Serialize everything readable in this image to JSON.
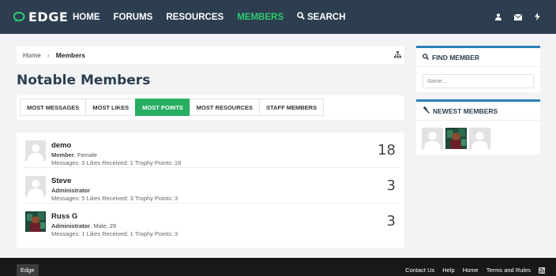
{
  "colors": {
    "header_bg": "#2c3e50",
    "accent": "#27ae60",
    "active_nav": "#2ecc71",
    "sidebar_border": "#2980b9",
    "footer_bg": "#161819"
  },
  "brand": {
    "name": "EDGE",
    "icon": "speech-bubble-logo-icon"
  },
  "nav": {
    "items": [
      {
        "label": "HOME"
      },
      {
        "label": "FORUMS"
      },
      {
        "label": "RESOURCES"
      },
      {
        "label": "MEMBERS",
        "active": true
      },
      {
        "label": "SEARCH",
        "icon": "search-icon"
      }
    ],
    "right_icons": [
      "user-icon",
      "envelope-icon",
      "bolt-icon"
    ]
  },
  "breadcrumb": {
    "home": "Home",
    "separator": "›",
    "current": "Members",
    "icon": "sitemap-icon"
  },
  "page_title": "Notable Members",
  "tabs": [
    {
      "label": "MOST MESSAGES"
    },
    {
      "label": "MOST LIKES"
    },
    {
      "label": "MOST POINTS",
      "active": true
    },
    {
      "label": "MOST RESOURCES"
    },
    {
      "label": "STAFF MEMBERS"
    }
  ],
  "members": [
    {
      "name": "demo",
      "role": "Member",
      "extra": ", Female",
      "stats": "Messages: 0 Likes Received: 1 Trophy Points: 18",
      "points": "18",
      "avatar": "default-avatar"
    },
    {
      "name": "Steve",
      "role": "Administrator",
      "extra": "",
      "stats": "Messages: 5 Likes Received: 3 Trophy Points: 3",
      "points": "3",
      "avatar": "default-avatar"
    },
    {
      "name": "Russ G",
      "role": "Administrator",
      "extra": ", Male, 29",
      "stats": "Messages: 1 Likes Received: 1 Trophy Points: 3",
      "points": "3",
      "avatar": "photo-avatar"
    }
  ],
  "sidebar": {
    "find": {
      "title": "FIND MEMBER",
      "icon": "search-icon",
      "placeholder": "Name..."
    },
    "newest": {
      "title": "NEWEST MEMBERS",
      "icon": "gavel-icon",
      "avatars": [
        "default-avatar",
        "photo-avatar",
        "default-avatar"
      ]
    }
  },
  "footer": {
    "brand": "Edge",
    "links": [
      {
        "label": "Contact Us"
      },
      {
        "label": "Help"
      },
      {
        "label": "Home"
      },
      {
        "label": "Terms and Rules"
      }
    ],
    "rss_icon": "rss-icon"
  }
}
